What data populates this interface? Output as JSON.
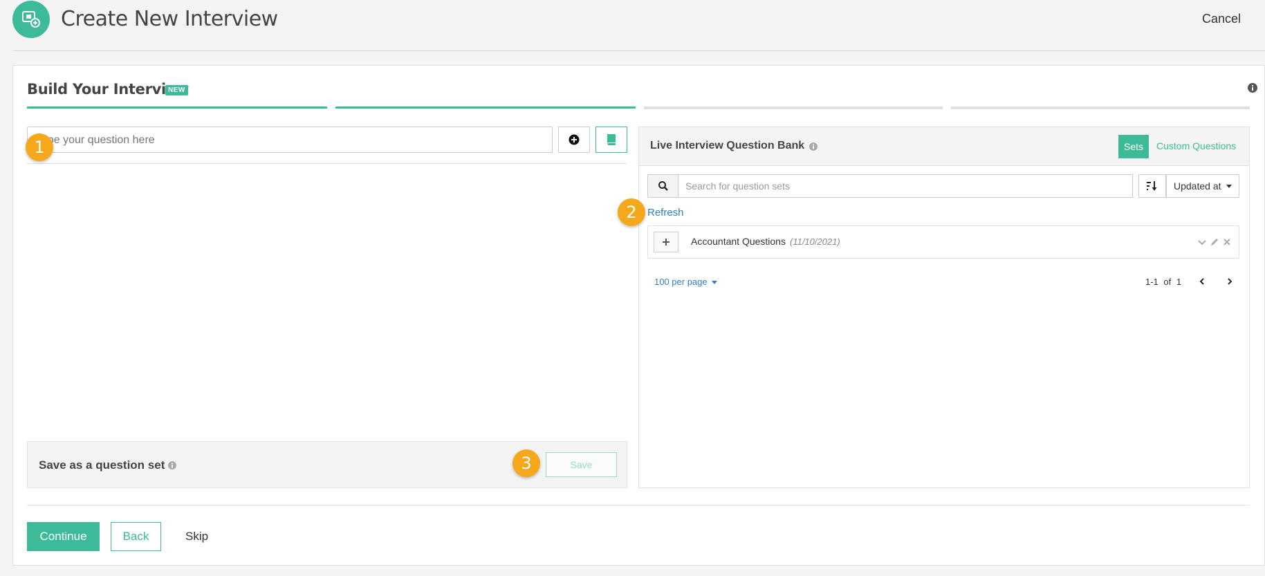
{
  "header": {
    "title": "Create New Interview",
    "cancel_label": "Cancel"
  },
  "builder": {
    "title": "Build Your Interview",
    "badge": "NEW",
    "steps_total": 4,
    "steps_completed": 2,
    "question_placeholder": "Type your question here"
  },
  "markers": [
    "1",
    "2",
    "3"
  ],
  "save_set": {
    "label": "Save as a question set",
    "save_label": "Save"
  },
  "bank": {
    "title": "Live Interview Question Bank",
    "tabs": [
      {
        "label": "Sets",
        "active": true
      },
      {
        "label": "Custom Questions",
        "active": false
      }
    ],
    "search_placeholder": "Search for question sets",
    "sort_label": "Updated at",
    "refresh_label": "Refresh",
    "sets": [
      {
        "name": "Accountant Questions",
        "date": "(11/10/2021)"
      }
    ],
    "per_page": "100 per page",
    "pager_range": "1-1",
    "pager_of": "of",
    "pager_total": "1"
  },
  "footer": {
    "continue_label": "Continue",
    "back_label": "Back",
    "skip_label": "Skip"
  },
  "colors": {
    "accent": "#3dba97",
    "link": "#2f7fc1",
    "marker": "#f5a81c"
  }
}
